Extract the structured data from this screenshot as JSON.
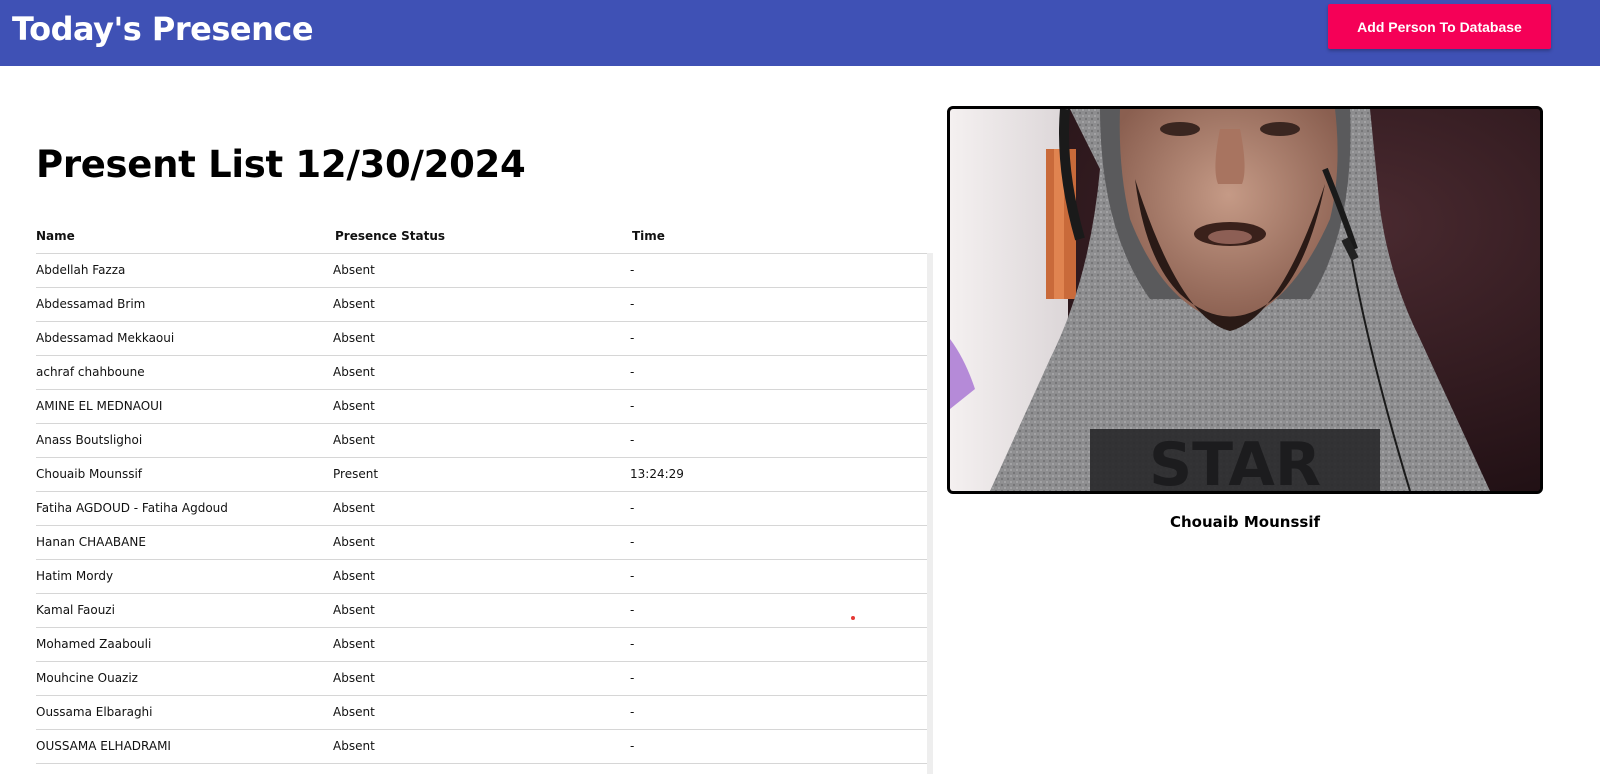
{
  "header": {
    "title": "Today's Presence",
    "add_button_label": "Add Person To Database",
    "bar_color": "#3f51b5",
    "button_color": "#f50057"
  },
  "main": {
    "heading": "Present List 12/30/2024",
    "columns": [
      "Name",
      "Presence Status",
      "Time"
    ],
    "rows": [
      {
        "name": "Abdellah Fazza",
        "status": "Absent",
        "time": "-"
      },
      {
        "name": "Abdessamad Brim",
        "status": "Absent",
        "time": "-"
      },
      {
        "name": "Abdessamad Mekkaoui",
        "status": "Absent",
        "time": "-"
      },
      {
        "name": "achraf chahboune",
        "status": "Absent",
        "time": "-"
      },
      {
        "name": "AMINE EL MEDNAOUI",
        "status": "Absent",
        "time": "-"
      },
      {
        "name": "Anass Boutslighoi",
        "status": "Absent",
        "time": "-"
      },
      {
        "name": "Chouaib Mounssif",
        "status": "Present",
        "time": "13:24:29"
      },
      {
        "name": "Fatiha AGDOUD - Fatiha Agdoud",
        "status": "Absent",
        "time": "-"
      },
      {
        "name": "Hanan CHAABANE",
        "status": "Absent",
        "time": "-"
      },
      {
        "name": "Hatim Mordy",
        "status": "Absent",
        "time": "-"
      },
      {
        "name": "Kamal Faouzi",
        "status": "Absent",
        "time": "-"
      },
      {
        "name": "Mohamed Zaabouli",
        "status": "Absent",
        "time": "-"
      },
      {
        "name": "Mouhcine Ouaziz",
        "status": "Absent",
        "time": "-"
      },
      {
        "name": "Oussama Elbaraghi",
        "status": "Absent",
        "time": "-"
      },
      {
        "name": "OUSSAMA ELHADRAMI",
        "status": "Absent",
        "time": "-"
      }
    ]
  },
  "camera": {
    "detected_name": "Chouaib Mounssif",
    "shirt_text": "STAR"
  }
}
